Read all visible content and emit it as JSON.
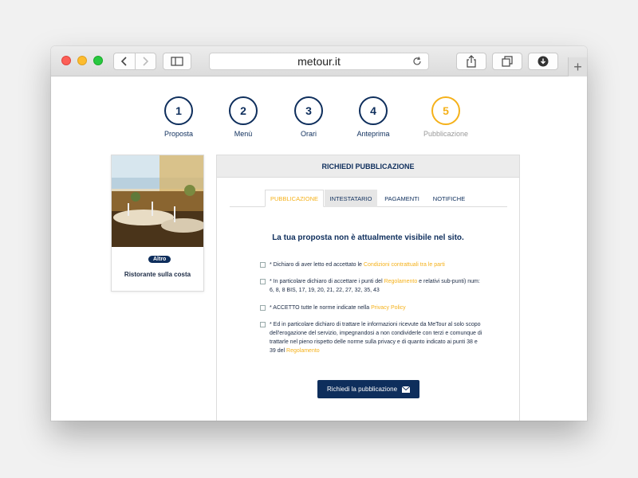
{
  "browser": {
    "url": "metour.it"
  },
  "steps": [
    {
      "num": "1",
      "label": "Proposta"
    },
    {
      "num": "2",
      "label": "Menù"
    },
    {
      "num": "3",
      "label": "Orari"
    },
    {
      "num": "4",
      "label": "Anteprima"
    },
    {
      "num": "5",
      "label": "Pubblicazione"
    }
  ],
  "card": {
    "badge": "Altro",
    "title": "Ristorante sulla costa"
  },
  "panel": {
    "title": "RICHIEDI PUBBLICAZIONE",
    "tabs": [
      "PUBBLICAZIONE",
      "INTESTATARIO",
      "PAGAMENTI",
      "NOTIFICHE"
    ],
    "notice": "La tua proposta non è attualmente visibile nel sito.",
    "checks": [
      {
        "before": "* Dichiaro di aver letto ed accettato le ",
        "link": "Condizioni contrattuali tra le parti",
        "after": ""
      },
      {
        "before": "* In particolare dichiaro di accettare i punti del ",
        "link": "Regolamento",
        "after": " e relativi sub-punti) num: 6, 8, 8 BIS, 17, 19, 20, 21, 22, 27, 32, 35, 43"
      },
      {
        "before": "* ACCETTO tutte le norme indicate nella ",
        "link": "Privacy Policy",
        "after": ""
      },
      {
        "before": "* Ed in particolare dichiaro di trattare le informazioni ricevute da MeTour al solo scopo dell'erogazione del servizio, impegnandosi a non condividerle con terzi e comunque di trattarle nel pieno rispetto delle norme sulla privacy e di quanto indicato ai punti 38 e 39 del ",
        "link": "Regolamento",
        "after": ""
      }
    ],
    "submit_label": "Richiedi la pubblicazione"
  },
  "colors": {
    "navy": "#0e2e5c",
    "accent": "#f5b11a"
  },
  "icons": [
    "back-icon",
    "forward-icon",
    "sidebar-icon",
    "reload-icon",
    "share-icon",
    "tabs-icon",
    "download-icon",
    "plus-icon",
    "envelope-icon"
  ]
}
